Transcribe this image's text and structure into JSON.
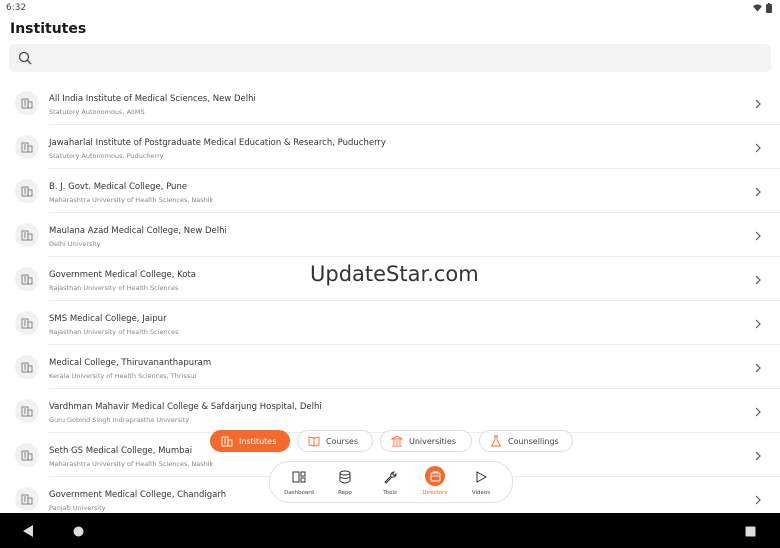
{
  "status": {
    "time": "6:32"
  },
  "header": {
    "title": "Institutes"
  },
  "search": {
    "placeholder": ""
  },
  "institutes": [
    {
      "name": "All India Institute of Medical Sciences, New Delhi",
      "sub": "Statutory Autonomous, AIIMS"
    },
    {
      "name": "Jawaharlal Institute of Postgraduate Medical Education & Research, Puducherry",
      "sub": "Statutory Autonomous, Puducherry"
    },
    {
      "name": "B. J. Govt. Medical College, Pune",
      "sub": "Maharashtra University of Health Sciences, Nashik"
    },
    {
      "name": "Maulana Azad Medical College, New Delhi",
      "sub": "Delhi University"
    },
    {
      "name": "Government Medical College, Kota",
      "sub": "Rajasthan University of Health Sciences"
    },
    {
      "name": "SMS Medical College, Jaipur",
      "sub": "Rajasthan University of Health Sciences"
    },
    {
      "name": "Medical College, Thiruvananthapuram",
      "sub": "Kerala University of Health Sciences, Thrissur"
    },
    {
      "name": "Vardhman Mahavir Medical College & Safdarjung Hospital, Delhi",
      "sub": "Guru Gobind Singh Indraprastha University"
    },
    {
      "name": "Seth GS Medical College, Mumbai",
      "sub": "Maharashtra University of Health Sciences, Nashik"
    },
    {
      "name": "Government Medical College, Chandigarh",
      "sub": "Panjab University"
    }
  ],
  "watermark": "UpdateStar.com",
  "chips": [
    {
      "label": "Institutes",
      "icon": "building-icon",
      "active": true
    },
    {
      "label": "Courses",
      "icon": "book-icon",
      "active": false
    },
    {
      "label": "Universities",
      "icon": "university-icon",
      "active": false
    },
    {
      "label": "Counsellings",
      "icon": "flask-icon",
      "active": false
    }
  ],
  "nav": [
    {
      "label": "Dashboard",
      "icon": "dashboard-icon"
    },
    {
      "label": "Repo",
      "icon": "database-icon"
    },
    {
      "label": "Tools",
      "icon": "wrench-icon"
    },
    {
      "label": "Directory",
      "icon": "directory-icon",
      "active": true
    },
    {
      "label": "Videos",
      "icon": "play-icon"
    }
  ],
  "colors": {
    "accent": "#f36a2f",
    "background": "#ffffff",
    "search_bg": "#f3f3f3"
  }
}
